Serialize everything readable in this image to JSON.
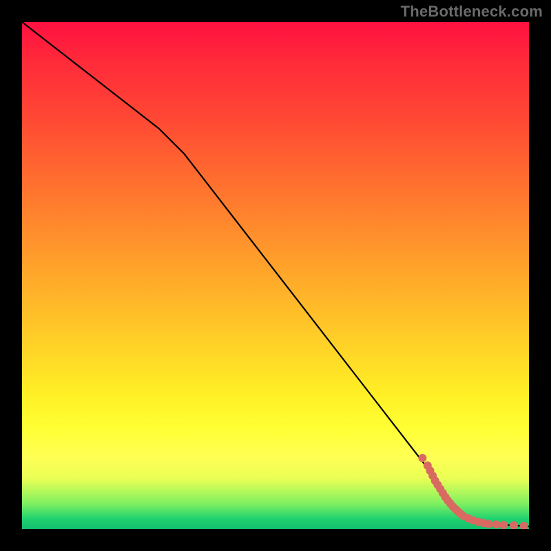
{
  "attribution": "TheBottleneck.com",
  "chart_data": {
    "type": "line",
    "title": "",
    "xlabel": "",
    "ylabel": "",
    "xlim": [
      0,
      100
    ],
    "ylim": [
      0,
      100
    ],
    "grid": false,
    "legend": false,
    "background": "heatmap-gradient-red-yellow-green-vertical",
    "series": [
      {
        "name": "curve",
        "style": "line",
        "color": "#000000",
        "points": [
          {
            "x": 0,
            "y": 100
          },
          {
            "x": 27,
            "y": 79
          },
          {
            "x": 32,
            "y": 74
          },
          {
            "x": 80,
            "y": 12
          },
          {
            "x": 84,
            "y": 6
          },
          {
            "x": 88,
            "y": 2.5
          },
          {
            "x": 92,
            "y": 1
          },
          {
            "x": 100,
            "y": 0.5
          }
        ]
      },
      {
        "name": "dots-tail",
        "style": "scatter",
        "color": "#d86a62",
        "points": [
          {
            "x": 79,
            "y": 14
          },
          {
            "x": 80,
            "y": 12.5
          },
          {
            "x": 80.5,
            "y": 11.5
          },
          {
            "x": 81,
            "y": 10.5
          },
          {
            "x": 81.5,
            "y": 9.5
          },
          {
            "x": 82,
            "y": 8.7
          },
          {
            "x": 82.5,
            "y": 7.9
          },
          {
            "x": 83,
            "y": 7.1
          },
          {
            "x": 83.5,
            "y": 6.3
          },
          {
            "x": 84,
            "y": 5.6
          },
          {
            "x": 84.5,
            "y": 5.0
          },
          {
            "x": 85,
            "y": 4.4
          },
          {
            "x": 85.5,
            "y": 3.9
          },
          {
            "x": 86,
            "y": 3.4
          },
          {
            "x": 86.5,
            "y": 3.0
          },
          {
            "x": 87,
            "y": 2.6
          },
          {
            "x": 88,
            "y": 2.1
          },
          {
            "x": 89,
            "y": 1.7
          },
          {
            "x": 90,
            "y": 1.4
          },
          {
            "x": 91,
            "y": 1.2
          },
          {
            "x": 92,
            "y": 1.0
          },
          {
            "x": 93.5,
            "y": 0.9
          },
          {
            "x": 95,
            "y": 0.8
          },
          {
            "x": 97,
            "y": 0.7
          },
          {
            "x": 99,
            "y": 0.6
          }
        ]
      }
    ]
  }
}
